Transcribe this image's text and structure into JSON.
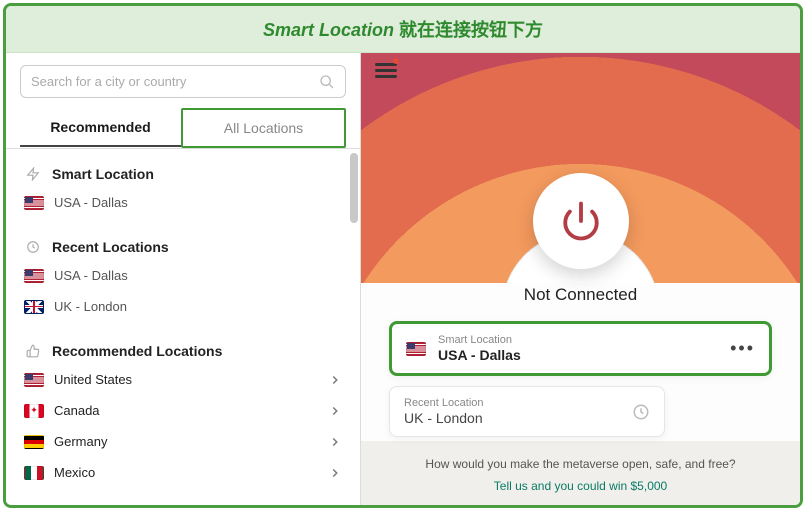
{
  "banner": {
    "italic": "Smart Location",
    "rest": " 就在连接按钮下方"
  },
  "search": {
    "placeholder": "Search for a city or country"
  },
  "tabs": {
    "recommended": "Recommended",
    "all": "All Locations"
  },
  "sections": {
    "smart": "Smart Location",
    "recent": "Recent Locations",
    "recommended": "Recommended Locations"
  },
  "smart_item": {
    "label": "USA - Dallas",
    "flag": "us"
  },
  "recent_items": [
    {
      "label": "USA - Dallas",
      "flag": "us"
    },
    {
      "label": "UK - London",
      "flag": "uk"
    }
  ],
  "recommended_items": [
    {
      "label": "United States",
      "flag": "us"
    },
    {
      "label": "Canada",
      "flag": "ca"
    },
    {
      "label": "Germany",
      "flag": "de"
    },
    {
      "label": "Mexico",
      "flag": "mx"
    }
  ],
  "status": "Not Connected",
  "main_card": {
    "title": "Smart Location",
    "subtitle": "USA - Dallas",
    "flag": "us"
  },
  "recent_card": {
    "title": "Recent Location",
    "subtitle": "UK - London"
  },
  "promo": {
    "line1": "How would you make the metaverse open, safe, and free?",
    "link": "Tell us and you could win $5,000"
  }
}
